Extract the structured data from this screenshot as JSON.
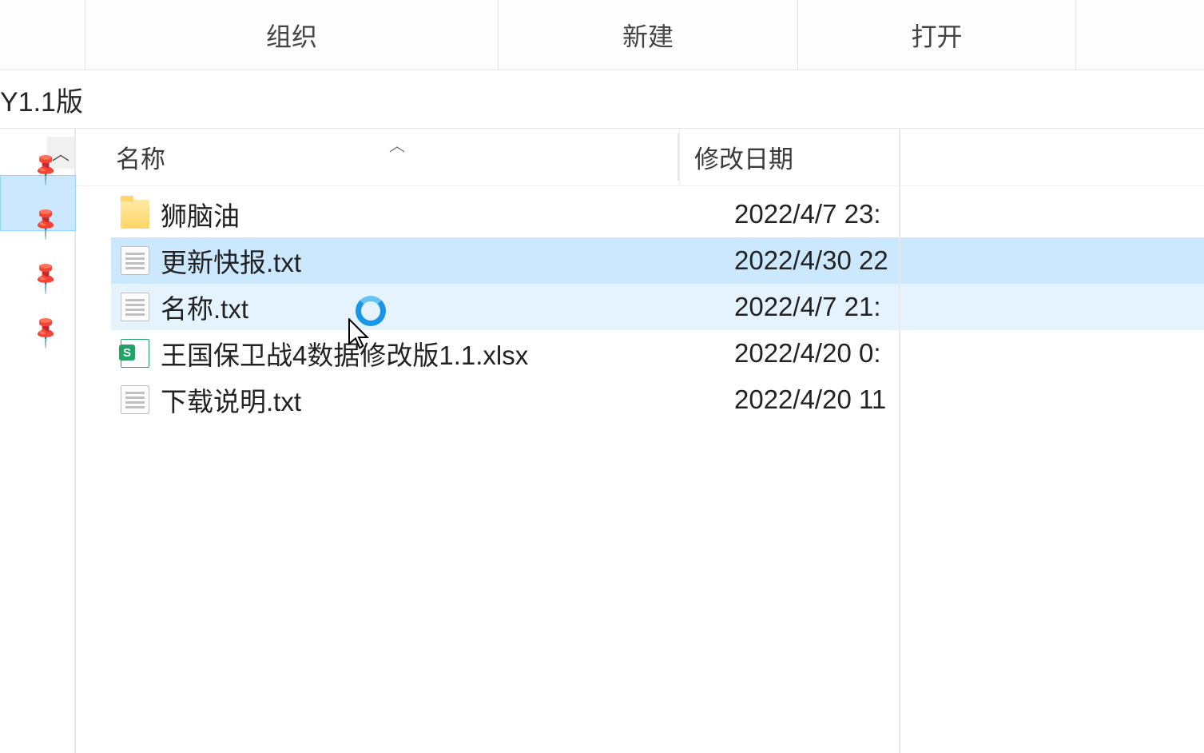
{
  "ribbon": {
    "organize": "组织",
    "new": "新建",
    "open": "打开"
  },
  "address": {
    "path_fragment": "Y1.1版"
  },
  "columns": {
    "name": "名称",
    "date": "修改日期"
  },
  "files": [
    {
      "icon": "folder",
      "name": "狮脑油",
      "date": "2022/4/7 23:",
      "selected": false,
      "hover": false
    },
    {
      "icon": "txt",
      "name": "更新快报.txt",
      "date": "2022/4/30 22",
      "selected": true,
      "hover": false
    },
    {
      "icon": "txt",
      "name": "名称.txt",
      "date": "2022/4/7 21:",
      "selected": false,
      "hover": true
    },
    {
      "icon": "xlsx",
      "name": "王国保卫战4数据修改版1.1.xlsx",
      "date": "2022/4/20 0:",
      "selected": false,
      "hover": false
    },
    {
      "icon": "txt",
      "name": "下载说明.txt",
      "date": "2022/4/20 11",
      "selected": false,
      "hover": false
    }
  ]
}
